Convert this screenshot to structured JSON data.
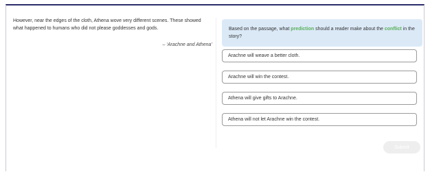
{
  "passage": {
    "text": "However, near the edges of the cloth, Athena wove very different scenes. These showed what happened to humans who did not please goddesses and gods.",
    "citation": "– ‘Arachne and Athena’"
  },
  "question": {
    "prefix": "Based on the passage, what ",
    "keyword1": "prediction",
    "middle": " should a reader make about the ",
    "keyword2": "conflict",
    "suffix": " in the story?",
    "keyword_color": "#58b058",
    "background_color": "#dbe9f7"
  },
  "choices": [
    {
      "label": "Arachne will weave a better cloth."
    },
    {
      "label": "Arachne will win the contest."
    },
    {
      "label": "Athena will give gifts to Arachne."
    },
    {
      "label": "Athena will not let Arachne win the contest."
    }
  ],
  "submit": {
    "label": "Submit",
    "enabled": false
  }
}
